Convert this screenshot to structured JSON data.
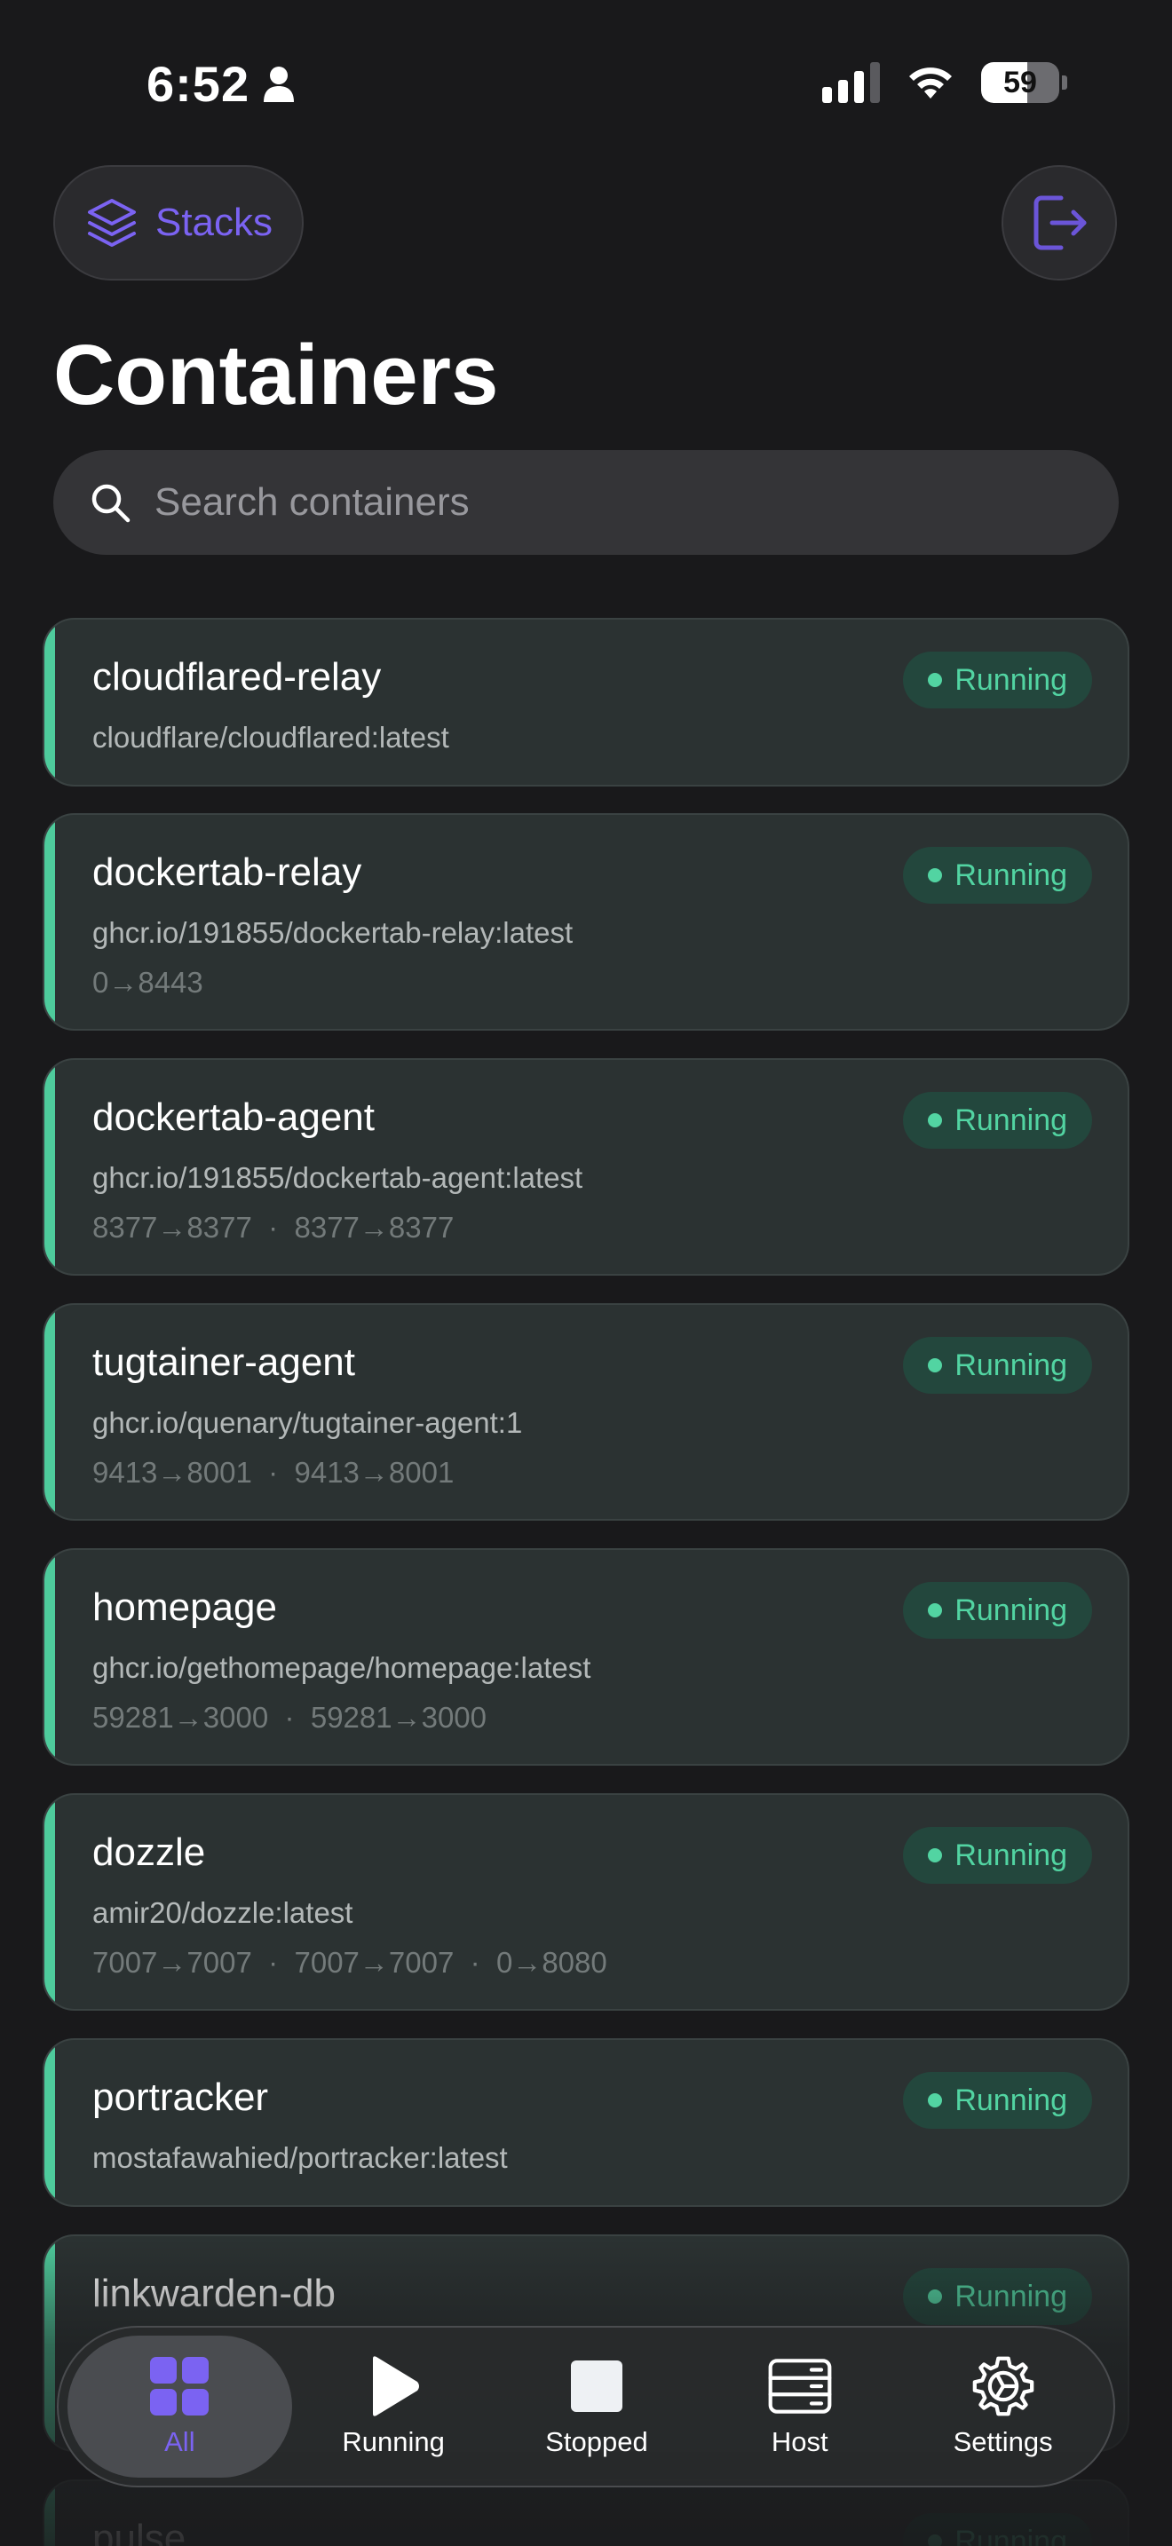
{
  "status_bar": {
    "time": "6:52",
    "battery": "59",
    "battery_fraction": 0.59
  },
  "header": {
    "stacks_label": "Stacks",
    "title": "Containers"
  },
  "search": {
    "placeholder": "Search containers"
  },
  "colors": {
    "accent": "#7b63f2",
    "running": "#52d4a2",
    "card_bg": "#2b3232",
    "page_bg": "#19191b"
  },
  "containers": [
    {
      "name": "cloudflared-relay",
      "image": "cloudflare/cloudflared:latest",
      "ports": "",
      "status": "Running"
    },
    {
      "name": "dockertab-relay",
      "image": "ghcr.io/191855/dockertab-relay:latest",
      "ports": "0→8443",
      "status": "Running"
    },
    {
      "name": "dockertab-agent",
      "image": "ghcr.io/191855/dockertab-agent:latest",
      "ports": "8377→8377  ·  8377→8377",
      "status": "Running"
    },
    {
      "name": "tugtainer-agent",
      "image": "ghcr.io/quenary/tugtainer-agent:1",
      "ports": "9413→8001  ·  9413→8001",
      "status": "Running"
    },
    {
      "name": "homepage",
      "image": "ghcr.io/gethomepage/homepage:latest",
      "ports": "59281→3000  ·  59281→3000",
      "status": "Running"
    },
    {
      "name": "dozzle",
      "image": "amir20/dozzle:latest",
      "ports": "7007→7007  ·  7007→7007  ·  0→8080",
      "status": "Running"
    },
    {
      "name": "portracker",
      "image": "mostafawahied/portracker:latest",
      "ports": "",
      "status": "Running"
    },
    {
      "name": "linkwarden-db",
      "image": "",
      "ports": "",
      "status": "Running"
    },
    {
      "name": "pulse",
      "image": "",
      "ports": "",
      "status": "Running"
    }
  ],
  "tabbar": {
    "items": [
      {
        "label": "All",
        "icon": "grid-icon",
        "active": true
      },
      {
        "label": "Running",
        "icon": "play-icon",
        "active": false
      },
      {
        "label": "Stopped",
        "icon": "stop-icon",
        "active": false
      },
      {
        "label": "Host",
        "icon": "server-icon",
        "active": false
      },
      {
        "label": "Settings",
        "icon": "gear-icon",
        "active": false
      }
    ]
  }
}
